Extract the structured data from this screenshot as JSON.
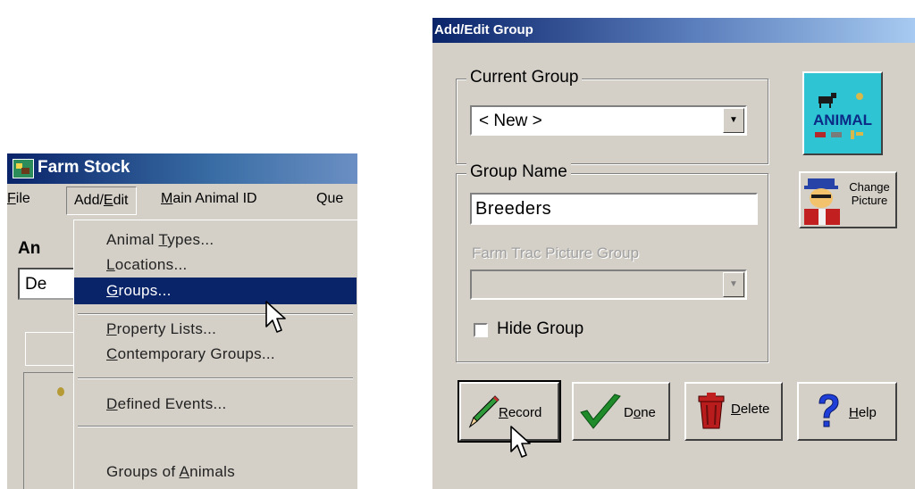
{
  "left_window": {
    "title": "Farm Stock",
    "menu": {
      "file": "File",
      "add_edit": "Add/Edit",
      "main_animal_id": "Main Animal ID",
      "query": "Que"
    },
    "body_label": "An",
    "combo_text": "De",
    "dropdown": {
      "items": [
        "Animal Types...",
        "Locations...",
        "Groups...",
        "Property Lists...",
        "Contemporary Groups...",
        "Defined Events...",
        "Groups of Animals"
      ],
      "selected": "Groups..."
    }
  },
  "dialog": {
    "title": "Add/Edit Group",
    "current_group_legend": "Current Group",
    "current_group_value": "< New >",
    "group_name_legend": "Group Name",
    "group_name_value": "Breeders",
    "picture_group_label": "Farm Trac Picture Group",
    "picture_group_value": "",
    "hide_group_label": "Hide Group",
    "hide_group_checked": false,
    "animal_logo_text": "ANIMAL",
    "change_picture_label": "Change Picture",
    "buttons": {
      "record": "Record",
      "done": "Done",
      "delete": "Delete",
      "help": "Help"
    }
  }
}
